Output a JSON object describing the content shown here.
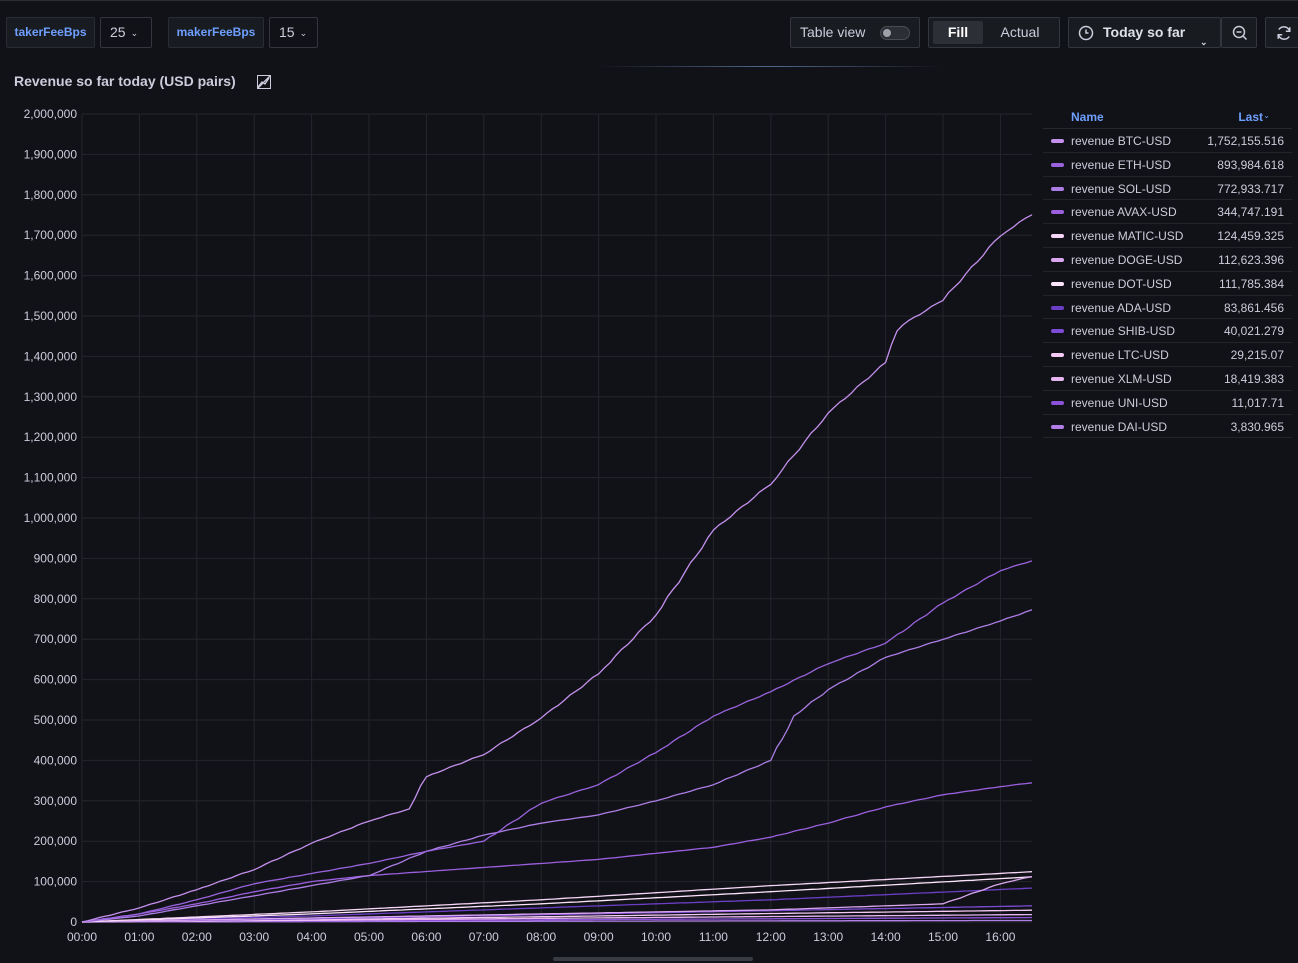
{
  "toolbar": {
    "vars": [
      {
        "label": "takerFeeBps",
        "value": "25"
      },
      {
        "label": "makerFeeBps",
        "value": "15"
      }
    ],
    "table_view_label": "Table view",
    "table_view_on": false,
    "fill_label": "Fill",
    "actual_label": "Actual",
    "time_range_label": "Today so far",
    "zoom_icon": "zoom-out-icon",
    "refresh_icon": "refresh-icon"
  },
  "panel": {
    "title": "Revenue so far today (USD pairs)",
    "title_icon": "tooltip-off-icon"
  },
  "colors": {
    "background": "#111217",
    "grid": "#24262d",
    "series_primary": "#b58be6",
    "series_dark": "#7d4cd6",
    "series_light": "#f4c9f3"
  },
  "legend": {
    "name_header": "Name",
    "last_header": "Last",
    "sort": "descending",
    "rows": [
      {
        "name": "revenue BTC-USD",
        "last": "1,752,155.516",
        "color": "#c490ec"
      },
      {
        "name": "revenue ETH-USD",
        "last": "893,984.618",
        "color": "#9a63de"
      },
      {
        "name": "revenue SOL-USD",
        "last": "772,933.717",
        "color": "#ad7de6"
      },
      {
        "name": "revenue AVAX-USD",
        "last": "344,747.191",
        "color": "#9b5fe0"
      },
      {
        "name": "revenue MATIC-USD",
        "last": "124,459.325",
        "color": "#f6d6f6"
      },
      {
        "name": "revenue DOGE-USD",
        "last": "112,623.396",
        "color": "#d9a6ef"
      },
      {
        "name": "revenue DOT-USD",
        "last": "111,785.384",
        "color": "#fbe4fa"
      },
      {
        "name": "revenue ADA-USD",
        "last": "83,861.456",
        "color": "#6b3ec6"
      },
      {
        "name": "revenue SHIB-USD",
        "last": "40,021.279",
        "color": "#7d4cd6"
      },
      {
        "name": "revenue LTC-USD",
        "last": "29,215.07",
        "color": "#f4c9f3"
      },
      {
        "name": "revenue XLM-USD",
        "last": "18,419.383",
        "color": "#e6b5f0"
      },
      {
        "name": "revenue UNI-USD",
        "last": "11,017.71",
        "color": "#8a52d8"
      },
      {
        "name": "revenue DAI-USD",
        "last": "3,830.965",
        "color": "#b27ee8"
      }
    ]
  },
  "chart_data": {
    "type": "line",
    "title": "Revenue so far today (USD pairs)",
    "xlabel": "",
    "ylabel": "",
    "x_unit": "hours",
    "xlim": [
      0,
      16.55
    ],
    "ylim": [
      0,
      2000000
    ],
    "x_ticks": [
      "00:00",
      "01:00",
      "02:00",
      "03:00",
      "04:00",
      "05:00",
      "06:00",
      "07:00",
      "08:00",
      "09:00",
      "10:00",
      "11:00",
      "12:00",
      "13:00",
      "14:00",
      "15:00",
      "16:00"
    ],
    "y_ticks": [
      "0",
      "100,000",
      "200,000",
      "300,000",
      "400,000",
      "500,000",
      "600,000",
      "700,000",
      "800,000",
      "900,000",
      "1,000,000",
      "1,100,000",
      "1,200,000",
      "1,300,000",
      "1,400,000",
      "1,500,000",
      "1,600,000",
      "1,700,000",
      "1,800,000",
      "1,900,000",
      "2,000,000"
    ],
    "grid": true,
    "legend_position": "right",
    "series": [
      {
        "name": "revenue BTC-USD",
        "color": "#c490ec",
        "x": [
          0,
          1,
          2,
          3,
          4,
          5,
          5.7,
          6,
          7,
          8,
          9,
          10,
          11,
          12,
          13,
          14,
          14.2,
          15,
          16,
          16.55
        ],
        "y": [
          0,
          35000,
          80000,
          130000,
          195000,
          250000,
          280000,
          360000,
          415000,
          505000,
          615000,
          760000,
          970000,
          1085000,
          1260000,
          1385000,
          1470000,
          1540000,
          1700000,
          1752155
        ]
      },
      {
        "name": "revenue ETH-USD",
        "color": "#9a63de",
        "x": [
          0,
          1,
          2,
          3,
          4,
          5,
          6,
          7,
          8,
          9,
          10,
          11,
          12,
          13,
          14,
          15,
          16,
          16.55
        ],
        "y": [
          0,
          20000,
          55000,
          95000,
          120000,
          145000,
          175000,
          200000,
          295000,
          340000,
          420000,
          510000,
          570000,
          640000,
          690000,
          790000,
          870000,
          893985
        ]
      },
      {
        "name": "revenue SOL-USD",
        "color": "#ad7de6",
        "x": [
          0,
          1,
          2,
          3,
          4,
          5,
          6,
          7,
          8,
          9,
          10,
          11,
          12,
          12.4,
          13,
          14,
          15,
          16,
          16.55
        ],
        "y": [
          0,
          15000,
          40000,
          65000,
          90000,
          115000,
          175000,
          215000,
          245000,
          265000,
          300000,
          340000,
          400000,
          510000,
          575000,
          655000,
          700000,
          745000,
          772934
        ]
      },
      {
        "name": "revenue AVAX-USD",
        "color": "#9b5fe0",
        "x": [
          0,
          1,
          2,
          3,
          4,
          5,
          6,
          7,
          8,
          9,
          10,
          11,
          12,
          13,
          14,
          15,
          16,
          16.55
        ],
        "y": [
          0,
          20000,
          45000,
          75000,
          100000,
          115000,
          125000,
          135000,
          145000,
          155000,
          170000,
          185000,
          210000,
          245000,
          285000,
          315000,
          335000,
          344747
        ]
      },
      {
        "name": "revenue MATIC-USD",
        "color": "#f6d6f6",
        "x": [
          0,
          4,
          8,
          12,
          16.55
        ],
        "y": [
          0,
          25000,
          55000,
          90000,
          124459
        ]
      },
      {
        "name": "revenue DOGE-USD",
        "color": "#d9a6ef",
        "x": [
          0,
          4,
          8,
          12,
          15,
          16,
          16.55
        ],
        "y": [
          0,
          10000,
          20000,
          30000,
          45000,
          95000,
          112623
        ]
      },
      {
        "name": "revenue DOT-USD",
        "color": "#fbe4fa",
        "x": [
          0,
          4,
          8,
          12,
          16.55
        ],
        "y": [
          0,
          20000,
          45000,
          75000,
          111785
        ]
      },
      {
        "name": "revenue ADA-USD",
        "color": "#6b3ec6",
        "x": [
          0,
          4,
          8,
          12,
          16.55
        ],
        "y": [
          0,
          15000,
          35000,
          55000,
          83861
        ]
      },
      {
        "name": "revenue SHIB-USD",
        "color": "#7d4cd6",
        "x": [
          0,
          4,
          8,
          12,
          16.55
        ],
        "y": [
          0,
          8000,
          18000,
          28000,
          40021
        ]
      },
      {
        "name": "revenue LTC-USD",
        "color": "#f4c9f3",
        "x": [
          0,
          4,
          8,
          12,
          16.55
        ],
        "y": [
          0,
          6000,
          13000,
          21000,
          29215
        ]
      },
      {
        "name": "revenue XLM-USD",
        "color": "#e6b5f0",
        "x": [
          0,
          4,
          8,
          12,
          16.55
        ],
        "y": [
          0,
          4000,
          9000,
          13500,
          18419
        ]
      },
      {
        "name": "revenue UNI-USD",
        "color": "#8a52d8",
        "x": [
          0,
          4,
          8,
          12,
          16.55
        ],
        "y": [
          0,
          2500,
          5500,
          8000,
          11018
        ]
      },
      {
        "name": "revenue DAI-USD",
        "color": "#b27ee8",
        "x": [
          0,
          4,
          8,
          12,
          16.55
        ],
        "y": [
          0,
          900,
          1900,
          2800,
          3831
        ]
      }
    ]
  }
}
